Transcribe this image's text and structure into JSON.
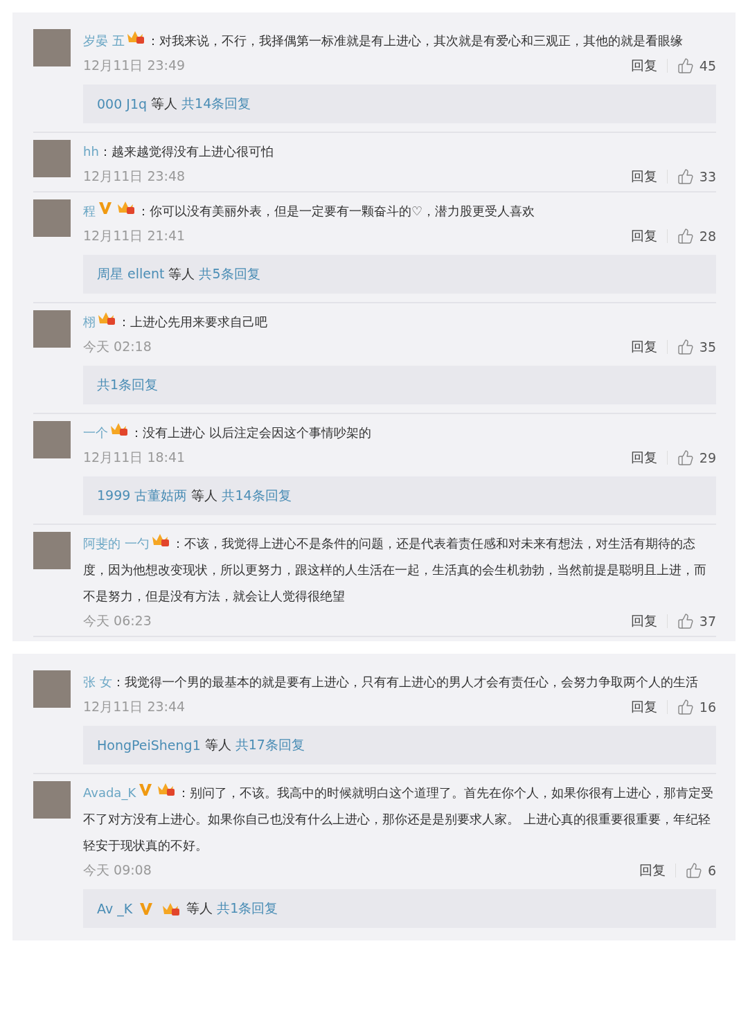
{
  "panels": [
    {
      "comments": [
        {
          "name": "岁晏 五",
          "badges": {
            "verified": false,
            "member": true
          },
          "text": "：对我来说，不行，我择偶第一标准就是有上进心，其次就是有爱心和三观正，其他的就是看眼缘",
          "time": "12月11日 23:49",
          "reply": "回复",
          "likes": "45",
          "replies": {
            "users": [
              {
                "name": "000 J1q",
                "badges": {
                  "verified": false,
                  "member": false
                }
              }
            ],
            "others": "等人",
            "count": "共14条回复"
          }
        },
        {
          "name": "hh",
          "badges": {
            "verified": false,
            "member": false
          },
          "text": "：越来越觉得没有上进心很可怕",
          "time": "12月11日 23:48",
          "reply": "回复",
          "likes": "33"
        },
        {
          "name": "程",
          "badges": {
            "verified": true,
            "member": true
          },
          "text": "：你可以没有美丽外表，但是一定要有一颗奋斗的♡，潜力股更受人喜欢",
          "time": "12月11日 21:41",
          "reply": "回复",
          "likes": "28",
          "replies": {
            "users": [
              {
                "name": "周星 ellent",
                "badges": {
                  "verified": false,
                  "member": false
                }
              }
            ],
            "others": "等人",
            "count": "共5条回复"
          }
        },
        {
          "name": "栩",
          "badges": {
            "verified": false,
            "member": true
          },
          "text": "：上进心先用来要求自己吧",
          "time": "今天 02:18",
          "reply": "回复",
          "likes": "35",
          "replies": {
            "count": "共1条回复"
          }
        },
        {
          "name": "一个",
          "badges": {
            "verified": false,
            "member": true
          },
          "text": "：没有上进心  以后注定会因这个事情吵架的",
          "time": "12月11日 18:41",
          "reply": "回复",
          "likes": "29",
          "replies": {
            "users": [
              {
                "name": "1999 古董姑两",
                "badges": {
                  "verified": false,
                  "member": false
                }
              }
            ],
            "others": "等人",
            "count": "共14条回复"
          }
        },
        {
          "name": "阿斐的 一勺",
          "badges": {
            "verified": false,
            "member": true
          },
          "text": "：不该，我觉得上进心不是条件的问题，还是代表着责任感和对未来有想法，对生活有期待的态度，因为他想改变现状，所以更努力，跟这样的人生活在一起，生活真的会生机勃勃，当然前提是聪明且上进，而不是努力，但是没有方法，就会让人觉得很绝望",
          "time": "今天 06:23",
          "reply": "回复",
          "likes": "37"
        }
      ]
    },
    {
      "comments": [
        {
          "name": "张 女",
          "badges": {
            "verified": false,
            "member": false
          },
          "text": "：我觉得一个男的最基本的就是要有上进心，只有有上进心的男人才会有责任心，会努力争取两个人的生活",
          "time": "12月11日 23:44",
          "reply": "回复",
          "likes": "16",
          "replies": {
            "users": [
              {
                "name": "HongPeiSheng1",
                "badges": {
                  "verified": false,
                  "member": false
                }
              }
            ],
            "others": "等人",
            "count": "共17条回复"
          }
        },
        {
          "name": "Avada_K",
          "badges": {
            "verified": true,
            "member": true
          },
          "text": "：别问了，不该。我高中的时候就明白这个道理了。首先在你个人，如果你很有上进心，那肯定受不了对方没有上进心。如果你自己也没有什么上进心，那你还是是别要求人家。 上进心真的很重要很重要，年纪轻轻安于现状真的不好。",
          "time": "今天 09:08",
          "reply": "回复",
          "likes": "6",
          "replies": {
            "users": [
              {
                "name": "Av _K",
                "badges": {
                  "verified": true,
                  "member": true
                }
              }
            ],
            "others": "等人",
            "count": "共1条回复"
          }
        }
      ]
    }
  ]
}
